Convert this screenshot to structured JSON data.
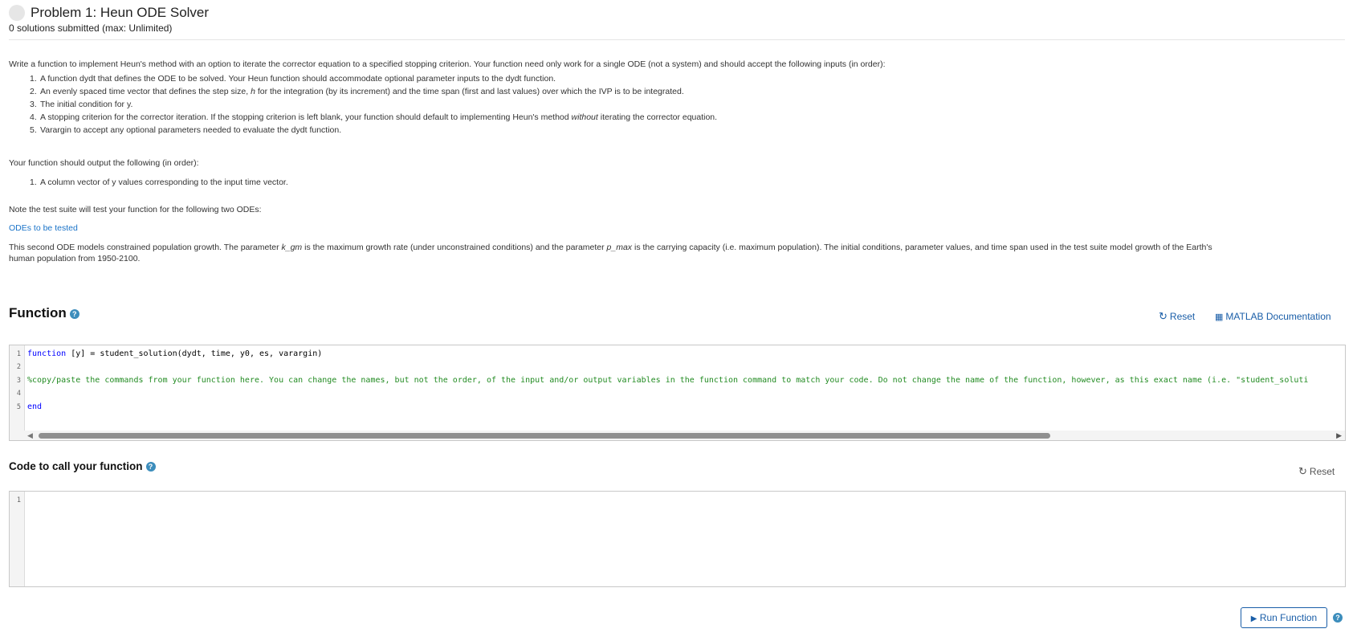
{
  "header": {
    "title": "Problem 1: Heun ODE Solver",
    "submissions": "0 solutions submitted (max: Unlimited)"
  },
  "description": {
    "intro": "Write a function to implement Heun's method with an option to iterate the corrector equation to a specified stopping criterion. Your function need only work for a single ODE (not a system) and should accept the following inputs (in order):",
    "inputs": [
      {
        "num": "1.",
        "text": "A function dydt that defines the ODE to be solved. Your Heun function should accommodate optional parameter inputs to the dydt function."
      },
      {
        "num": "2.",
        "pre": "An evenly spaced time vector that defines the step size, ",
        "italic": "h",
        "post": " for the integration (by its increment) and the time span (first and last values) over which the IVP is to be integrated."
      },
      {
        "num": "3.",
        "text": "The initial condition for y."
      },
      {
        "num": "4.",
        "pre": "A stopping criterion for the corrector iteration. If the stopping criterion is left blank, your function should default to implementing Heun's method ",
        "italic": "without",
        "post": " iterating the corrector equation."
      },
      {
        "num": "5.",
        "text": "Varargin to accept any optional parameters needed to evaluate the dydt function."
      }
    ],
    "output_intro": "Your function should output the following (in order):",
    "outputs": [
      {
        "num": "1.",
        "text": "A column vector of y values corresponding to the input time vector."
      }
    ],
    "test_note": "Note the test suite will test your function for the following two ODEs:",
    "odes_link": "ODEs to be tested",
    "second_ode": {
      "p1": "This second ODE models constrained population growth. The parameter ",
      "i1": "k_gm",
      "p2": " is the maximum growth rate (under unconstrained conditions) and the parameter ",
      "i2": "p_max",
      "p3": " is the carrying capacity (i.e. maximum population). The initial conditions, parameter values, and time span used in the test suite model growth of the Earth's",
      "line2": "human population from 1950-2100."
    }
  },
  "function_section": {
    "title": "Function",
    "help_icon": "question-circle-icon",
    "reset_label": "Reset",
    "docs_label": "MATLAB Documentation",
    "line_numbers": [
      "1",
      "2",
      "3",
      "4",
      "5"
    ],
    "line1_kw": "function",
    "line1_rest": " [y] = student_solution(dydt, time, y0, es, varargin)",
    "line3": "%copy/paste the commands from your function here.  You can change the names, but not the order, of the input and/or output variables in the function command to match your code.  Do not change the name of the function, however, as this exact name (i.e. \"student_soluti",
    "line5": "end"
  },
  "call_section": {
    "title": "Code to call your function",
    "help_icon": "question-circle-icon",
    "reset_label": "Reset",
    "line_numbers": [
      "1"
    ]
  },
  "run_button": {
    "label": "Run Function",
    "icon": "play-icon"
  },
  "colors": {
    "link": "#1a73c8",
    "keyword": "#0000ff",
    "comment": "#228b22",
    "help": "#3c8dbc"
  }
}
